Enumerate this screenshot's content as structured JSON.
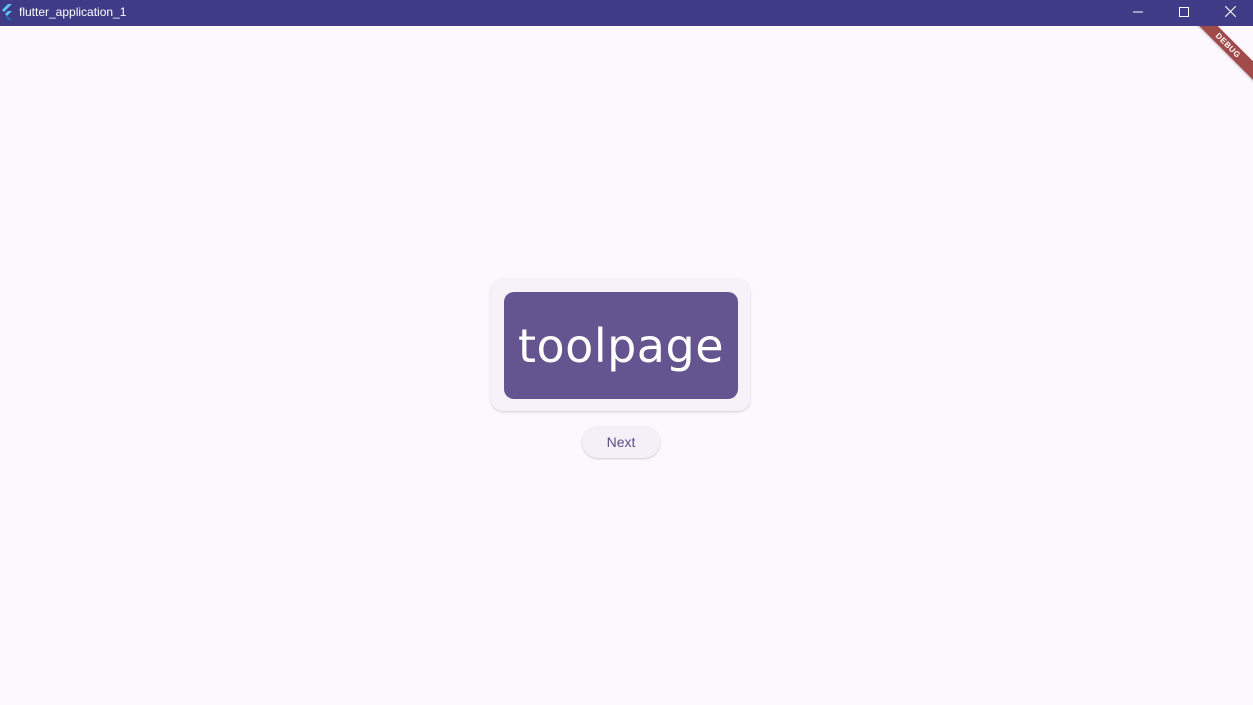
{
  "window": {
    "title": "flutter_application_1",
    "app_icon": "flutter-logo-icon",
    "controls": {
      "minimize_icon": "minimize-icon",
      "maximize_icon": "maximize-icon",
      "close_icon": "close-icon"
    }
  },
  "main": {
    "word": "toolpage",
    "next_label": "Next"
  },
  "debug_banner": {
    "label": "DEBUG"
  },
  "colors": {
    "titlebar": "#3f3b86",
    "background": "#fdf8fe",
    "card": "#f7f1f9",
    "word_box": "#645590",
    "button_text": "#5c4d86",
    "debug_ribbon": "#a14a4a"
  }
}
